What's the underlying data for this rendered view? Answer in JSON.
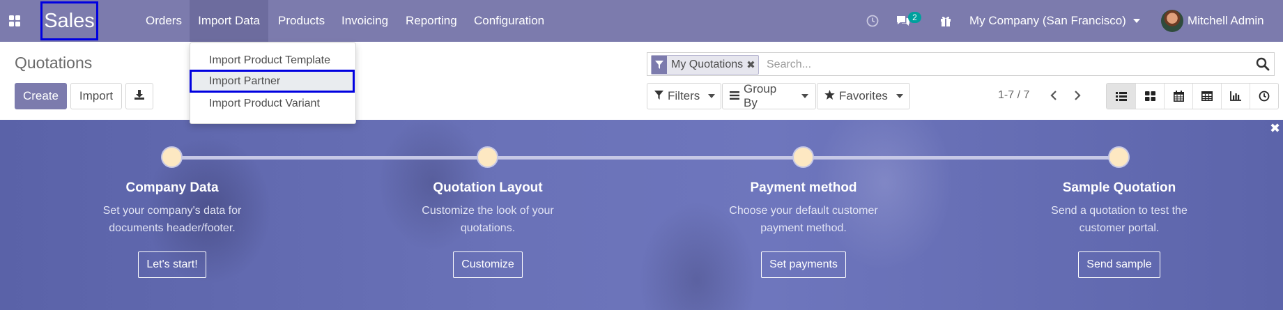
{
  "navbar": {
    "brand": "Sales",
    "menu": [
      "Orders",
      "Import Data",
      "Products",
      "Invoicing",
      "Reporting",
      "Configuration"
    ],
    "messages_count": "2",
    "company": "My Company (San Francisco)",
    "user": "Mitchell Admin"
  },
  "dropdown": {
    "items": [
      "Import Product Template",
      "Import Partner",
      "Import Product Variant"
    ]
  },
  "control_panel": {
    "title": "Quotations",
    "create_label": "Create",
    "import_label": "Import",
    "facet_label": "My Quotations",
    "search_placeholder": "Search...",
    "filters_label": "Filters",
    "groupby_label": "Group By",
    "favorites_label": "Favorites",
    "pager": "1-7 / 7",
    "views": [
      "list-view-icon",
      "kanban-view-icon",
      "calendar-view-icon",
      "pivot-view-icon",
      "graph-view-icon",
      "activity-view-icon"
    ]
  },
  "onboarding": {
    "steps": [
      {
        "title": "Company Data",
        "desc1": "Set your company's data for",
        "desc2": "documents header/footer.",
        "button": "Let's start!"
      },
      {
        "title": "Quotation Layout",
        "desc1": "Customize the look of your",
        "desc2": "quotations.",
        "button": "Customize"
      },
      {
        "title": "Payment method",
        "desc1": "Choose your default customer",
        "desc2": "payment method.",
        "button": "Set payments"
      },
      {
        "title": "Sample Quotation",
        "desc1": "Send a quotation to test the",
        "desc2": "customer portal.",
        "button": "Send sample"
      }
    ]
  },
  "colors": {
    "brand": "#7c7bad",
    "badge": "#00a09d",
    "highlight_border": "#0000e0"
  }
}
